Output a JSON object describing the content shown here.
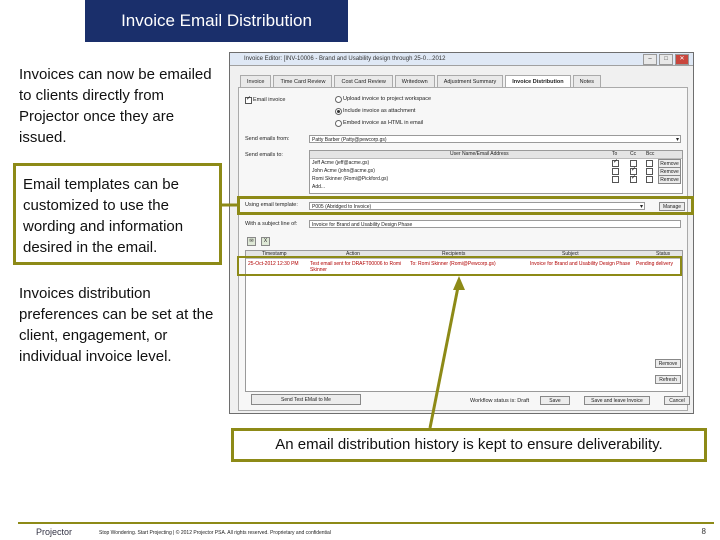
{
  "slide": {
    "title": "Invoice Email Distribution",
    "callouts": [
      "Invoices can now be emailed to clients directly from Projector once they are issued.",
      "Email templates can be customized to use the wording and information desired in the email.",
      "Invoices distribution preferences can be set at the client, engagement, or individual invoice level."
    ],
    "caption": "An email distribution history is kept to ensure deliverability.",
    "footer": {
      "logo": "Projector",
      "text": "Stop Wondering. Start Projecting | © 2012 Projector PSA. All rights reserved. Proprietary and confidential",
      "page": "8"
    },
    "colors": {
      "title_bg": "#1a2f6b",
      "accent": "#8d8a17"
    }
  },
  "dialog": {
    "title": "Invoice Editor: [INV-10006 - Brand and Usability design through 25-0…2012",
    "tabs": [
      "Invoice",
      "Time Card Review",
      "Cost Card Review",
      "Writedown",
      "Adjustment Summary",
      "Invoice Distribution",
      "Notes"
    ],
    "active_tab": "Invoice Distribution",
    "email_invoice_label": "Email invoice",
    "options": [
      "Upload invoice to project workspace",
      "Include invoice as attachment",
      "Embed invoice as HTML in email"
    ],
    "send_from_label": "Send emails from:",
    "send_from_value": "Patty Barber (Patty@pewcorp.gs)",
    "send_to_label": "Send emails to:",
    "recipients_header": {
      "name": "User Name/Email Address",
      "to": "To",
      "cc": "Cc",
      "bcc": "Bcc"
    },
    "recipients": [
      {
        "name": "Jeff Acme (jeff@acme.gs)",
        "remove": "Remove"
      },
      {
        "name": "John Acme (john@acme.gs)",
        "remove": "Remove"
      },
      {
        "name": "Romi Skinner (Romi@Pickford.gs)",
        "remove": "Remove"
      },
      {
        "name": "Add...",
        "remove": ""
      }
    ],
    "template_label": "Using email template:",
    "template_value": "P005 (Abridged to Invoice)",
    "manage_label": "Manage",
    "subject_label": "With a subject line of:",
    "subject_value": "Invoice for Brand and Usability Design Phase",
    "history_headers": [
      "Timestamp",
      "Action",
      "Recipients",
      "Subject",
      "Status"
    ],
    "history_rows": [
      {
        "timestamp": "25-Oct-2012 12:30 PM",
        "action": "Test email sent for DRAFT00006 to Romi Skinner",
        "recipients": "To: Romi Skinner (Romi@Pewcorp.gs)",
        "subject": "Invoice for Brand and Usability Design Phase",
        "status": "Pending delivery"
      }
    ],
    "remove_label": "Remove",
    "refresh_label": "Refresh",
    "send_test_label": "Send Test EMail to Me",
    "status_label": "Workflow status is: Draft",
    "save_label": "Save",
    "save_leave_label": "Save and leave Invoice",
    "cancel_label": "Cancel"
  }
}
